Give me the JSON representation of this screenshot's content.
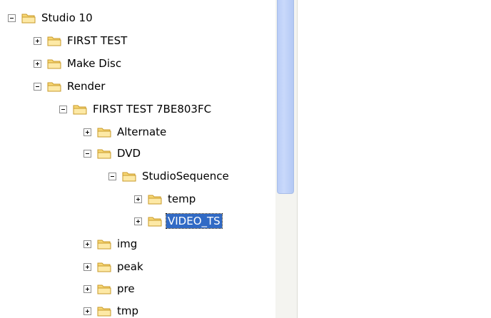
{
  "tree": {
    "nodes": [
      {
        "label": "Studio 10",
        "toggle": "minus"
      },
      {
        "label": "FIRST TEST",
        "toggle": "plus"
      },
      {
        "label": "Make Disc",
        "toggle": "plus"
      },
      {
        "label": "Render",
        "toggle": "minus"
      },
      {
        "label": "FIRST TEST 7BE803FC",
        "toggle": "minus"
      },
      {
        "label": "Alternate",
        "toggle": "plus"
      },
      {
        "label": "DVD",
        "toggle": "minus"
      },
      {
        "label": "StudioSequence",
        "toggle": "minus"
      },
      {
        "label": "temp",
        "toggle": "plus"
      },
      {
        "label": "VIDEO_TS",
        "toggle": "plus",
        "selected": true
      },
      {
        "label": "img",
        "toggle": "plus"
      },
      {
        "label": "peak",
        "toggle": "plus"
      },
      {
        "label": "pre",
        "toggle": "plus"
      },
      {
        "label": "tmp",
        "toggle": "plus"
      }
    ]
  },
  "icons": {
    "folder": "folder-icon",
    "expand": "plus-box-icon",
    "collapse": "minus-box-icon"
  },
  "colors": {
    "selection": "#316ac5",
    "folder_fill": "#f7d774",
    "scroll_thumb": "#c3d3f8"
  }
}
